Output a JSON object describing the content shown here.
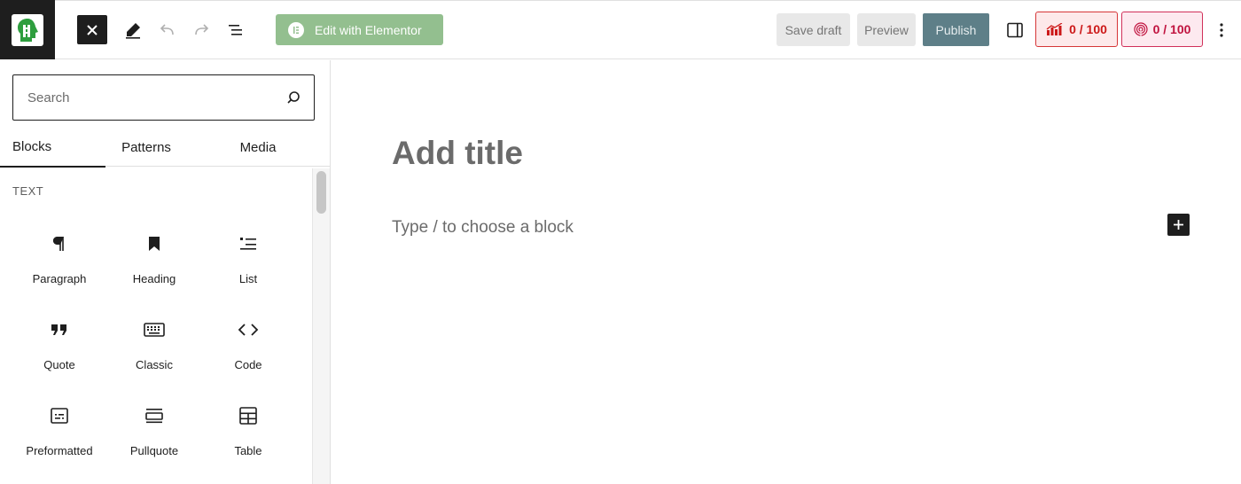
{
  "toolbar": {
    "elementor_label": "Edit with Elementor",
    "save_draft": "Save draft",
    "preview": "Preview",
    "publish": "Publish",
    "seo_score": "0 / 100",
    "readability_score": "0 / 100"
  },
  "sidebar": {
    "search_placeholder": "Search",
    "tabs": [
      {
        "label": "Blocks"
      },
      {
        "label": "Patterns"
      },
      {
        "label": "Media"
      }
    ],
    "section_title": "TEXT",
    "blocks": [
      {
        "label": "Paragraph",
        "icon": "paragraph-icon"
      },
      {
        "label": "Heading",
        "icon": "bookmark-icon"
      },
      {
        "label": "List",
        "icon": "list-icon"
      },
      {
        "label": "Quote",
        "icon": "quote-icon"
      },
      {
        "label": "Classic",
        "icon": "keyboard-icon"
      },
      {
        "label": "Code",
        "icon": "code-icon"
      },
      {
        "label": "Preformatted",
        "icon": "preformatted-icon"
      },
      {
        "label": "Pullquote",
        "icon": "pullquote-icon"
      },
      {
        "label": "Table",
        "icon": "table-icon"
      }
    ]
  },
  "editor": {
    "title_placeholder": "Add title",
    "block_placeholder": "Type / to choose a block"
  },
  "colors": {
    "elementor_green": "#93bf8f",
    "publish_bg": "#5e7f88",
    "seo_red": "#cc1818",
    "readability_pink": "#c0123e"
  }
}
